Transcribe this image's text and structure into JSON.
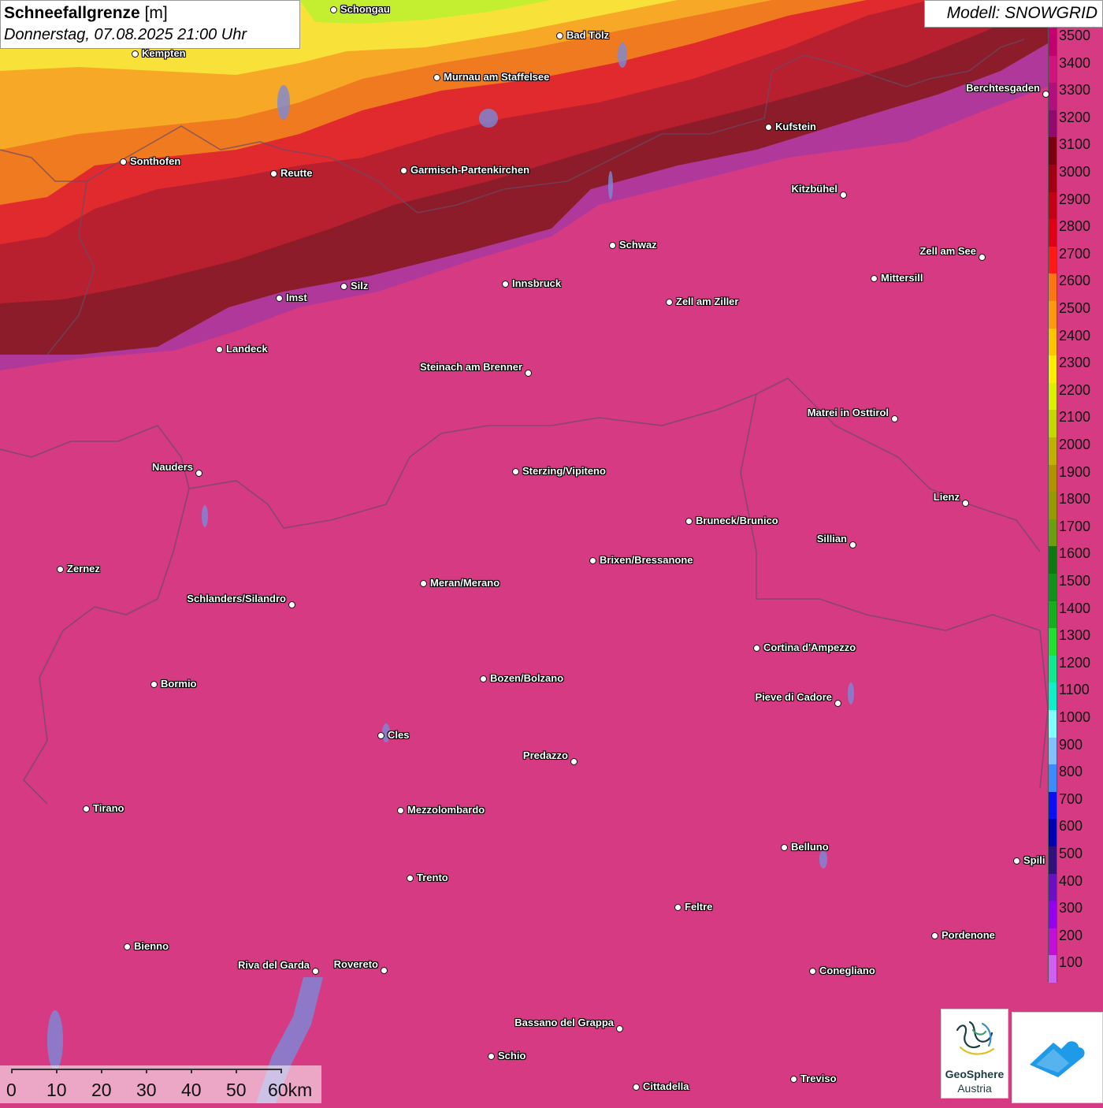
{
  "header": {
    "title_bold": "Schneefallgrenze",
    "title_unit": "[m]",
    "datetime": "Donnerstag, 07.08.2025 21:00 Uhr",
    "model": "Modell: SNOWGRID"
  },
  "legend": {
    "items": [
      {
        "label": "3500",
        "color": "#c2006e"
      },
      {
        "label": "3400",
        "color": "#d0147e"
      },
      {
        "label": "3300",
        "color": "#b0107a"
      },
      {
        "label": "3200",
        "color": "#8e0a6c"
      },
      {
        "label": "3100",
        "color": "#7a0010"
      },
      {
        "label": "3000",
        "color": "#a00012"
      },
      {
        "label": "2900",
        "color": "#c40014"
      },
      {
        "label": "2800",
        "color": "#e00016"
      },
      {
        "label": "2700",
        "color": "#ff1a14"
      },
      {
        "label": "2600",
        "color": "#ff7414"
      },
      {
        "label": "2500",
        "color": "#ff9a10"
      },
      {
        "label": "2400",
        "color": "#ffc400"
      },
      {
        "label": "2300",
        "color": "#ffee00"
      },
      {
        "label": "2200",
        "color": "#ddf000"
      },
      {
        "label": "2100",
        "color": "#c6d800"
      },
      {
        "label": "2000",
        "color": "#c0b000"
      },
      {
        "label": "1900",
        "color": "#b09200"
      },
      {
        "label": "1800",
        "color": "#949a00"
      },
      {
        "label": "1700",
        "color": "#6aa010"
      },
      {
        "label": "1600",
        "color": "#0c7a10"
      },
      {
        "label": "1500",
        "color": "#10921a"
      },
      {
        "label": "1400",
        "color": "#14b020"
      },
      {
        "label": "1300",
        "color": "#20e030"
      },
      {
        "label": "1200",
        "color": "#10e890"
      },
      {
        "label": "1100",
        "color": "#10f0c8"
      },
      {
        "label": "1000",
        "color": "#80ffff"
      },
      {
        "label": "900",
        "color": "#80c0ff"
      },
      {
        "label": "800",
        "color": "#3a8cff"
      },
      {
        "label": "700",
        "color": "#0a10f0"
      },
      {
        "label": "600",
        "color": "#0000b0"
      },
      {
        "label": "500",
        "color": "#30107a"
      },
      {
        "label": "400",
        "color": "#6a10c0"
      },
      {
        "label": "300",
        "color": "#9400ee"
      },
      {
        "label": "200",
        "color": "#c010d8"
      },
      {
        "label": "100",
        "color": "#d060f0"
      }
    ]
  },
  "zones": {
    "base": "#d63a82",
    "purple": "#b0389a",
    "darkred": "#8c1c2a",
    "red2": "#b82030",
    "red": "#e02a2e",
    "orange": "#f07a20",
    "amber": "#f6a826",
    "yellow": "#f8e23a",
    "green": "#c4ee30"
  },
  "cities": [
    {
      "name": "Schongau",
      "side": "right"
    },
    {
      "name": "Bad Tölz",
      "side": "right"
    },
    {
      "name": "Kempten",
      "side": "right"
    },
    {
      "name": "Murnau am Staffelsee",
      "side": "right"
    },
    {
      "name": "Berchtesgaden",
      "side": "left"
    },
    {
      "name": "Kufstein",
      "side": "right"
    },
    {
      "name": "Sonthofen",
      "side": "right"
    },
    {
      "name": "Reutte",
      "side": "right"
    },
    {
      "name": "Garmisch-Partenkirchen",
      "side": "right"
    },
    {
      "name": "Kitzbühel",
      "side": "left"
    },
    {
      "name": "Schwaz",
      "side": "right"
    },
    {
      "name": "Zell am See",
      "side": "left"
    },
    {
      "name": "Mittersill",
      "side": "right"
    },
    {
      "name": "Innsbruck",
      "side": "right"
    },
    {
      "name": "Zell am Ziller",
      "side": "right"
    },
    {
      "name": "Imst",
      "side": "right"
    },
    {
      "name": "Silz",
      "side": "right"
    },
    {
      "name": "Landeck",
      "side": "right"
    },
    {
      "name": "Steinach am Brenner",
      "side": "left"
    },
    {
      "name": "Matrei in Osttirol",
      "side": "left"
    },
    {
      "name": "Nauders",
      "side": "left"
    },
    {
      "name": "Sterzing/Vipiteno",
      "side": "right"
    },
    {
      "name": "Lienz",
      "side": "left"
    },
    {
      "name": "Bruneck/Brunico",
      "side": "right"
    },
    {
      "name": "Sillian",
      "side": "left"
    },
    {
      "name": "Zernez",
      "side": "right"
    },
    {
      "name": "Brixen/Bressanone",
      "side": "right"
    },
    {
      "name": "Meran/Merano",
      "side": "right"
    },
    {
      "name": "Schlanders/Silandro",
      "side": "left"
    },
    {
      "name": "Cortina d'Ampezzo",
      "side": "right"
    },
    {
      "name": "Bozen/Bolzano",
      "side": "right"
    },
    {
      "name": "Bormio",
      "side": "right"
    },
    {
      "name": "Pieve di Cadore",
      "side": "left"
    },
    {
      "name": "Cles",
      "side": "right"
    },
    {
      "name": "Predazzo",
      "side": "left"
    },
    {
      "name": "Tirano",
      "side": "right"
    },
    {
      "name": "Mezzolombardo",
      "side": "right"
    },
    {
      "name": "Belluno",
      "side": "right"
    },
    {
      "name": "Spili",
      "side": "right"
    },
    {
      "name": "Trento",
      "side": "right"
    },
    {
      "name": "Feltre",
      "side": "right"
    },
    {
      "name": "Pordenone",
      "side": "right"
    },
    {
      "name": "Bienno",
      "side": "right"
    },
    {
      "name": "Riva del Garda",
      "side": "left"
    },
    {
      "name": "Rovereto",
      "side": "left"
    },
    {
      "name": "Conegliano",
      "side": "right"
    },
    {
      "name": "Bassano del Grappa",
      "side": "left"
    },
    {
      "name": "Schio",
      "side": "right"
    },
    {
      "name": "Treviso",
      "side": "right"
    },
    {
      "name": "Cittadella",
      "side": "right"
    }
  ],
  "scale": {
    "labels": [
      "0",
      "10",
      "20",
      "30",
      "40",
      "50",
      "60km"
    ]
  },
  "logo": {
    "name": "GeoSphere",
    "sub": "Austria"
  }
}
